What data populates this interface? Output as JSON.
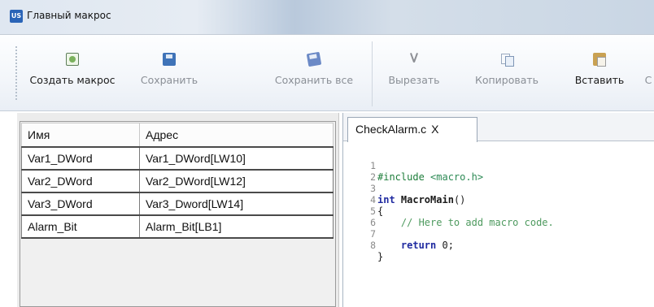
{
  "window": {
    "app_icon": "US",
    "title": "Главный макрос"
  },
  "toolbar": {
    "buttons": [
      {
        "label": "Создать макрос",
        "icon": "new-macro-icon",
        "state": "active"
      },
      {
        "label": "Сохранить",
        "icon": "save-icon",
        "state": "disabled"
      },
      {
        "label": "Сохранить все",
        "icon": "save-all-icon",
        "state": "disabled"
      },
      {
        "label": "Вырезать",
        "icon": "cut-icon",
        "state": "disabled"
      },
      {
        "label": "Копировать",
        "icon": "copy-icon",
        "state": "disabled"
      },
      {
        "label": "Вставить",
        "icon": "paste-icon",
        "state": "active"
      },
      {
        "label": "С",
        "icon": "",
        "state": "disabled"
      }
    ]
  },
  "variables": {
    "columns": [
      "Имя",
      "Адрес"
    ],
    "rows": [
      [
        "Var1_DWord",
        "Var1_DWord[LW10]"
      ],
      [
        "Var2_DWord",
        "Var2_DWord[LW12]"
      ],
      [
        "Var3_DWord",
        "Var3_Dword[LW14]"
      ],
      [
        "Alarm_Bit",
        "Alarm_Bit[LB1]"
      ]
    ]
  },
  "editor": {
    "tab_label": "CheckAlarm.c",
    "tab_close": "X",
    "line_numbers": [
      "1",
      "2",
      "3",
      "4",
      "5",
      "6",
      "7",
      "8"
    ],
    "lines": {
      "l1_directive": "#include",
      "l1_header": " <macro.h>",
      "l3_type": "int",
      "l3_name": " MacroMain",
      "l3_parens": "()",
      "l4_brace": "{",
      "l5_comment": "    // Here to add macro code.",
      "l7_return": "    return",
      "l7_value": " 0;",
      "l8_brace": "}"
    }
  },
  "colors": {
    "keyword": "#1f2aa0",
    "preprocessor": "#1d7d3a",
    "comment": "#4e9a5f",
    "disabled_label": "#8a8f96"
  }
}
